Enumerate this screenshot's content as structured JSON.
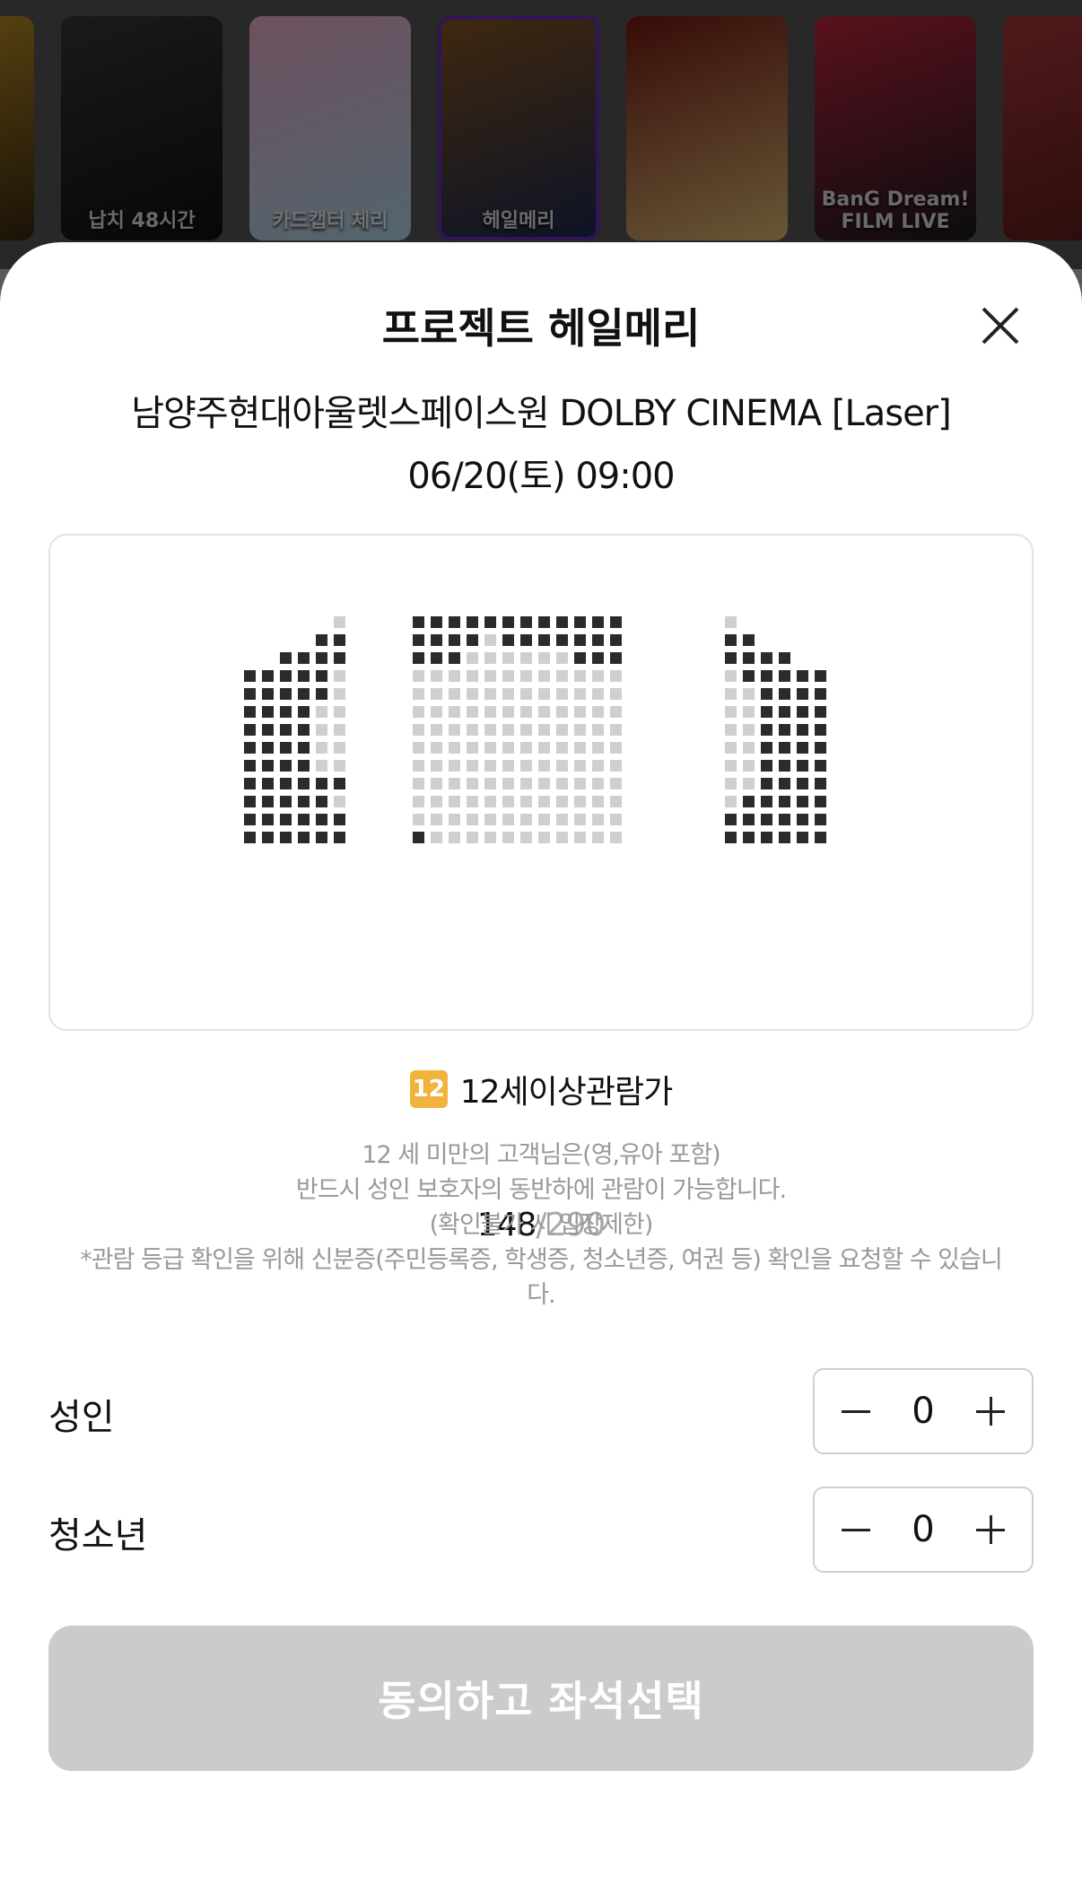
{
  "posters": [
    {
      "name": "poster-1",
      "title": "",
      "colors": [
        "#d4a02a",
        "#3b2a10"
      ]
    },
    {
      "name": "poster-2",
      "title": "납치 48시간",
      "colors": [
        "#3a3a3a",
        "#111111"
      ]
    },
    {
      "name": "poster-3",
      "title": "카드캡터 체리",
      "colors": [
        "#f3b3d3",
        "#b7e0f2"
      ]
    },
    {
      "name": "poster-4",
      "title": "헤일메리",
      "colors": [
        "#8c5a22",
        "#1c2a55"
      ],
      "selected": true
    },
    {
      "name": "poster-5",
      "title": "",
      "colors": [
        "#7a1a12",
        "#e6c27a"
      ]
    },
    {
      "name": "poster-6",
      "title": "BanG Dream! FILM LIVE",
      "colors": [
        "#c6283f",
        "#1a1a22"
      ]
    },
    {
      "name": "poster-7",
      "title": "",
      "colors": [
        "#b33a3a",
        "#5a1a1a"
      ]
    }
  ],
  "sheet": {
    "title": "프로젝트 헤일메리",
    "theater": "남양주현대아울렛스페이스원 DOLBY CINEMA [Laser]",
    "datetime": "06/20(토) 09:00"
  },
  "seats": {
    "available": "148",
    "separator": "/",
    "total": "290",
    "colors": {
      "booked": "#2b2b2b",
      "available": "#cfcfcf"
    }
  },
  "rating": {
    "badge": "12",
    "label": "12세이상관람가",
    "notice": [
      "12 세 미만의 고객님은(영,유아 포함)",
      "반드시 성인 보호자의 동반하에 관람이 가능합니다.",
      "(확인불가 시 입장제한)",
      "*관람 등급 확인을 위해 신분증(주민등록증, 학생증, 청소년증, 여권 등) 확인을 요청할 수 있습니",
      "다."
    ]
  },
  "quantities": [
    {
      "label": "성인",
      "value": "0"
    },
    {
      "label": "청소년",
      "value": "0"
    }
  ],
  "confirm_label": "동의하고 좌석선택",
  "icons": {
    "close": "close-icon",
    "minus": "minus-icon",
    "plus": "plus-icon"
  }
}
